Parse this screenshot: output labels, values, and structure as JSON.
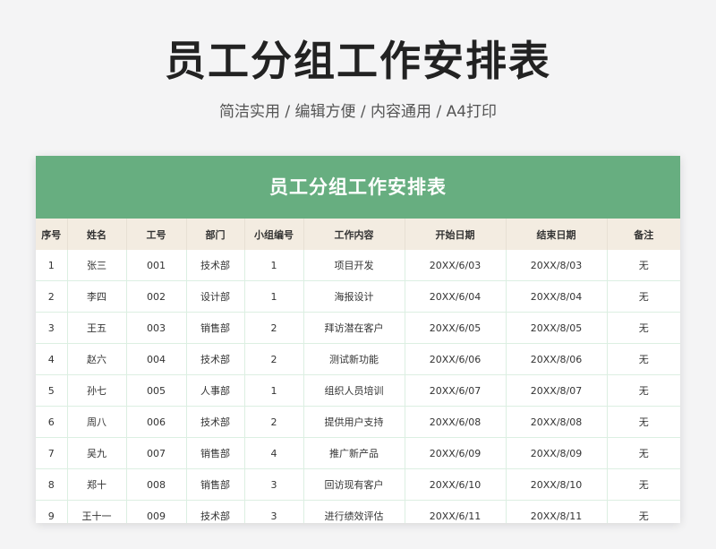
{
  "title": "员工分组工作安排表",
  "subtitle": "简洁实用 / 编辑方便 / 内容通用 / A4打印",
  "sheet": {
    "title": "员工分组工作安排表",
    "header_color": "#67ae80",
    "columns": [
      "序号",
      "姓名",
      "工号",
      "部门",
      "小组编号",
      "工作内容",
      "开始日期",
      "结束日期",
      "备注"
    ],
    "rows": [
      [
        "1",
        "张三",
        "001",
        "技术部",
        "1",
        "项目开发",
        "20XX/6/03",
        "20XX/8/03",
        "无"
      ],
      [
        "2",
        "李四",
        "002",
        "设计部",
        "1",
        "海报设计",
        "20XX/6/04",
        "20XX/8/04",
        "无"
      ],
      [
        "3",
        "王五",
        "003",
        "销售部",
        "2",
        "拜访潜在客户",
        "20XX/6/05",
        "20XX/8/05",
        "无"
      ],
      [
        "4",
        "赵六",
        "004",
        "技术部",
        "2",
        "测试新功能",
        "20XX/6/06",
        "20XX/8/06",
        "无"
      ],
      [
        "5",
        "孙七",
        "005",
        "人事部",
        "1",
        "组织人员培训",
        "20XX/6/07",
        "20XX/8/07",
        "无"
      ],
      [
        "6",
        "周八",
        "006",
        "技术部",
        "2",
        "提供用户支持",
        "20XX/6/08",
        "20XX/8/08",
        "无"
      ],
      [
        "7",
        "吴九",
        "007",
        "销售部",
        "4",
        "推广新产品",
        "20XX/6/09",
        "20XX/8/09",
        "无"
      ],
      [
        "8",
        "郑十",
        "008",
        "销售部",
        "3",
        "回访现有客户",
        "20XX/6/10",
        "20XX/8/10",
        "无"
      ],
      [
        "9",
        "王十一",
        "009",
        "技术部",
        "3",
        "进行绩效评估",
        "20XX/6/11",
        "20XX/8/11",
        "无"
      ]
    ]
  }
}
